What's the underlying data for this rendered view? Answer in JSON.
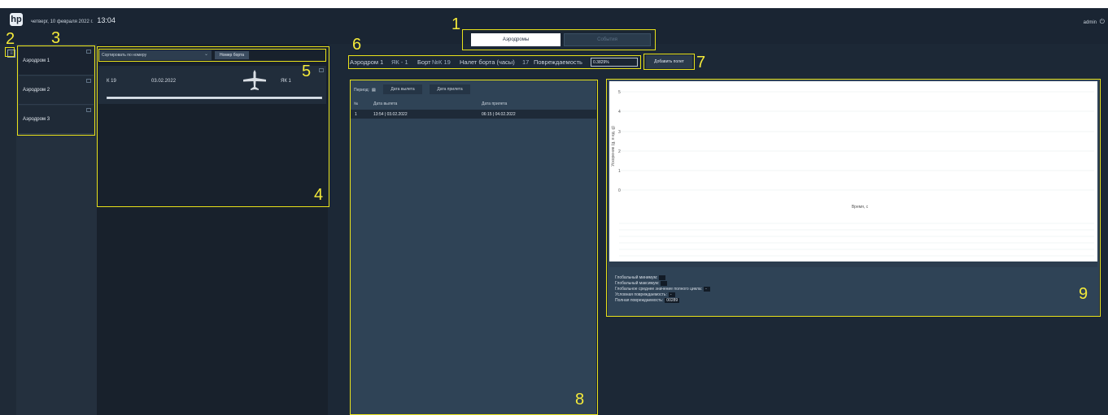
{
  "header": {
    "logo_text": "hp",
    "date": "четверг, 10 февраля 2022 г.",
    "time": "13:04",
    "user": "admin",
    "power_icon": "power-icon"
  },
  "tabs": [
    {
      "label": "Аэродромы",
      "active": true
    },
    {
      "label": "События",
      "active": false
    }
  ],
  "sidebar": {
    "collapse_icon": "collapse-icon",
    "items": [
      {
        "label": "Аэродром 1",
        "selected": true
      },
      {
        "label": "Аэродром 2",
        "selected": false
      },
      {
        "label": "Аэродром 3",
        "selected": false
      }
    ]
  },
  "flights": {
    "sort_label": "Сортировать по номеру",
    "sort_button": "Номер борта",
    "items": [
      {
        "side": "К 19",
        "date": "03.02.2022",
        "type": "ЯК 1"
      }
    ]
  },
  "info": {
    "aerodrome": "Аэродром 1",
    "type": "ЯК - 1",
    "side_label": "Борт",
    "side_value": "№К 19",
    "flight_hours_label": "Налет борта (часы)",
    "flight_hours_value": "17",
    "damage_label": "Повреждаемость",
    "damage_value": "0.3829%"
  },
  "add_flight_button": "Добавить полет",
  "period": {
    "label": "Период:",
    "depart_button": "Дата вылета",
    "arrive_button": "Дата прилета",
    "columns": [
      "№",
      "Дата вылета",
      "Дата прилета"
    ],
    "rows": [
      {
        "n": "1",
        "depart": "13:54 | 03.02.2022",
        "arrive": "06:15 | 04.02.2022"
      }
    ]
  },
  "chart": {
    "y_ticks": [
      "5",
      "4",
      "3",
      "2",
      "1",
      "0"
    ],
    "ylabel": "Ускорение (g, в ед. g)",
    "xlabel": "Время, с"
  },
  "stats": {
    "rows": [
      {
        "label": "Глобальный минимум:",
        "value": ""
      },
      {
        "label": "Глобальный максимум:",
        "value": ""
      },
      {
        "label": "Глобальное среднее значение полного цикла:",
        "value": "-"
      },
      {
        "label": "Условная повреждаемость:",
        "value": "-"
      },
      {
        "label": "Полная повреждаемость:",
        "value": "00289"
      }
    ]
  },
  "annotations": [
    "1",
    "2",
    "3",
    "4",
    "5",
    "6",
    "7",
    "8",
    "9"
  ]
}
